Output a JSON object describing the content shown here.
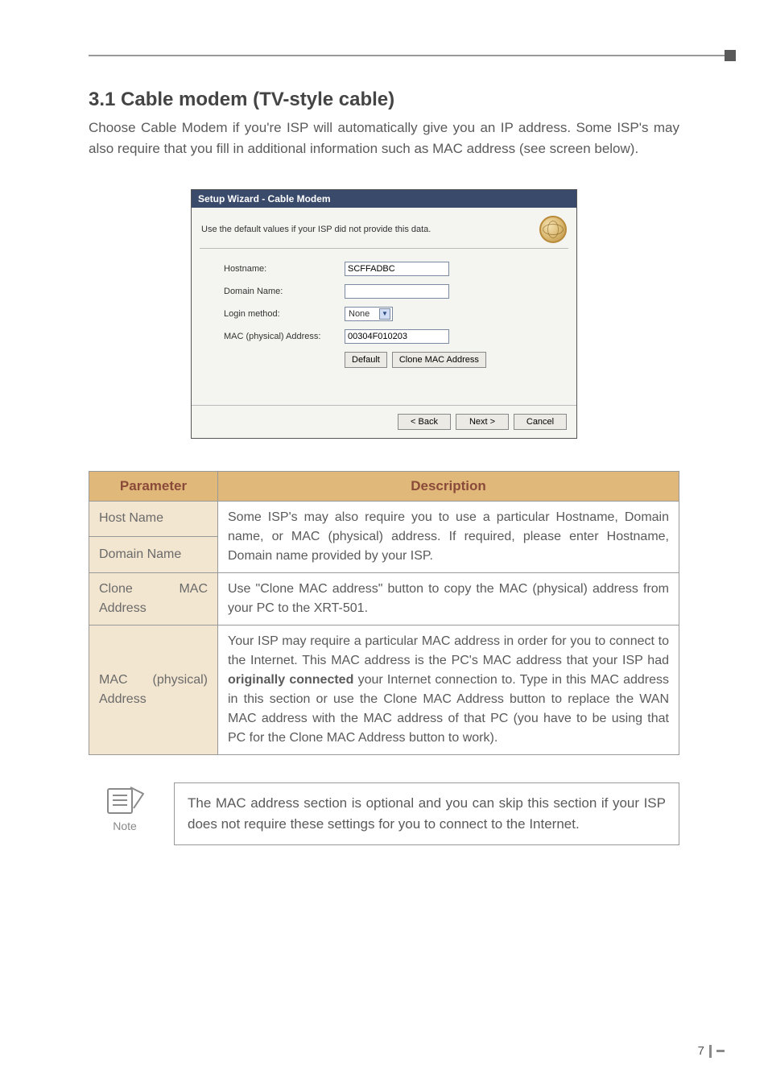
{
  "section": {
    "heading": "3.1 Cable modem (TV-style cable)",
    "intro": "Choose Cable Modem if you're ISP will automatically give you an IP address. Some ISP's may also require that you fill in additional information such as MAC address (see screen below)."
  },
  "wizard": {
    "title": "Setup Wizard - Cable Modem",
    "subtitle": "Use the default values if your ISP did not provide this data.",
    "fields": {
      "hostname_label": "Hostname:",
      "hostname_value": "SCFFADBC",
      "domain_label": "Domain Name:",
      "domain_value": "",
      "login_label": "Login method:",
      "login_value": "None",
      "mac_label": "MAC (physical) Address:",
      "mac_value": "00304F010203",
      "default_btn": "Default",
      "clone_btn": "Clone MAC Address"
    },
    "footer": {
      "back": "< Back",
      "next": "Next >",
      "cancel": "Cancel"
    }
  },
  "table": {
    "headers": {
      "param": "Parameter",
      "desc": "Description"
    },
    "rows": {
      "host_label": "Host Name",
      "domain_label": "Domain Name",
      "host_domain_desc": "Some ISP's may also require you to use a particular Hostname, Domain name, or MAC (physical) address. If required, please enter Hostname, Domain name provided by your ISP.",
      "clone_label": "Clone MAC Address",
      "clone_desc": "Use \"Clone MAC address\" button to copy the MAC (physical) address from your PC to the XRT-501.",
      "macphys_label": "MAC (physical) Address",
      "macphys_desc_pre": "Your ISP may require a particular MAC address in order for you to connect to the Internet. This MAC address is the PC's MAC address that your ISP had ",
      "macphys_desc_bold": "originally connected",
      "macphys_desc_post": " your Internet connection to. Type in this MAC address in this section or use the Clone MAC Address button to replace the WAN MAC address with the MAC address of that PC (you have to be using that PC for the Clone MAC Address button to work)."
    }
  },
  "note": {
    "label": "Note",
    "text": "The MAC address section is optional and you can skip this section if your ISP does not require these settings for you to connect to the Internet."
  },
  "page_number": "7"
}
